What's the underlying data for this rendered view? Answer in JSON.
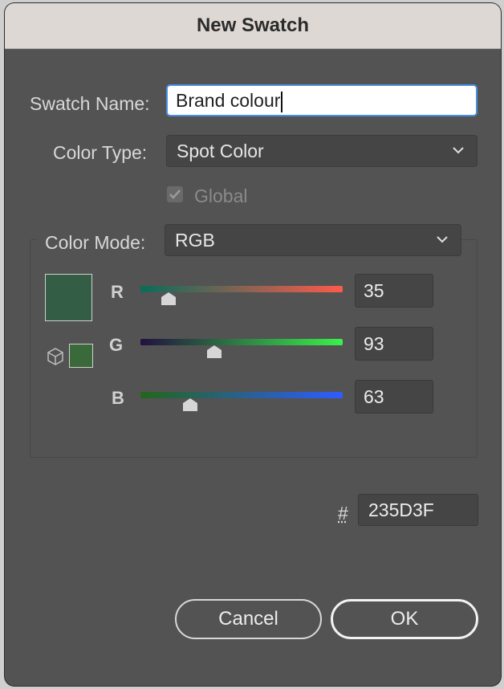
{
  "dialog": {
    "title": "New Swatch"
  },
  "swatch_name": {
    "label": "Swatch Name:",
    "value": "Brand colour"
  },
  "color_type": {
    "label": "Color Type:",
    "value": "Spot Color"
  },
  "global": {
    "label": "Global",
    "checked": true,
    "enabled": false
  },
  "color_mode": {
    "label": "Color Mode:",
    "value": "RGB"
  },
  "channels": [
    {
      "label": "R",
      "value": "35",
      "fraction": 0.137,
      "gradient": [
        "#0b6b5a",
        "#ff5a4a"
      ]
    },
    {
      "label": "G",
      "value": "93",
      "fraction": 0.365,
      "gradient": [
        "#23103f",
        "#3af24a"
      ]
    },
    {
      "label": "B",
      "value": "63",
      "fraction": 0.247,
      "gradient": [
        "#23661a",
        "#2f5cff"
      ]
    }
  ],
  "preview": {
    "current_color": "#335D45",
    "web_safe_color": "#3A6A3A"
  },
  "hex": {
    "label": "#",
    "value": "235D3F"
  },
  "buttons": {
    "cancel": "Cancel",
    "ok": "OK"
  },
  "icons": {
    "dropdown": "chevron-down-icon",
    "web_safe": "cube-icon",
    "thumb": "slider-thumb-icon"
  }
}
